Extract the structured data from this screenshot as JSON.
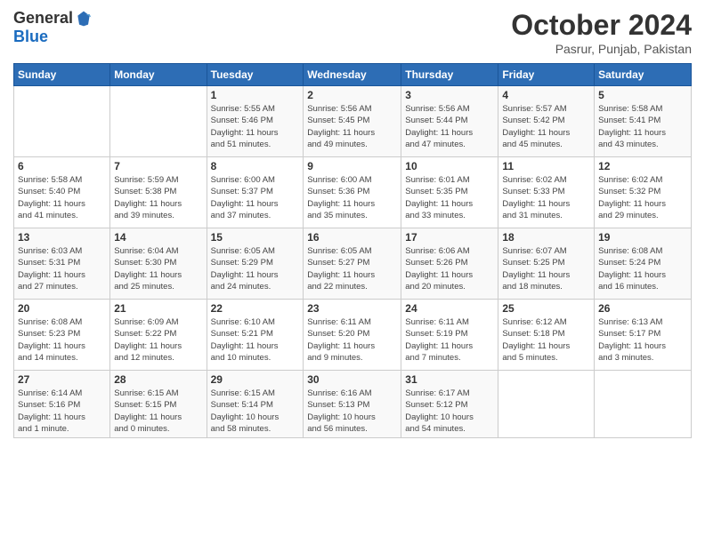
{
  "header": {
    "logo": {
      "general": "General",
      "blue": "Blue"
    },
    "title": "October 2024",
    "location": "Pasrur, Punjab, Pakistan"
  },
  "columns": [
    "Sunday",
    "Monday",
    "Tuesday",
    "Wednesday",
    "Thursday",
    "Friday",
    "Saturday"
  ],
  "weeks": [
    [
      {
        "day": "",
        "info": ""
      },
      {
        "day": "",
        "info": ""
      },
      {
        "day": "1",
        "info": "Sunrise: 5:55 AM\nSunset: 5:46 PM\nDaylight: 11 hours\nand 51 minutes."
      },
      {
        "day": "2",
        "info": "Sunrise: 5:56 AM\nSunset: 5:45 PM\nDaylight: 11 hours\nand 49 minutes."
      },
      {
        "day": "3",
        "info": "Sunrise: 5:56 AM\nSunset: 5:44 PM\nDaylight: 11 hours\nand 47 minutes."
      },
      {
        "day": "4",
        "info": "Sunrise: 5:57 AM\nSunset: 5:42 PM\nDaylight: 11 hours\nand 45 minutes."
      },
      {
        "day": "5",
        "info": "Sunrise: 5:58 AM\nSunset: 5:41 PM\nDaylight: 11 hours\nand 43 minutes."
      }
    ],
    [
      {
        "day": "6",
        "info": "Sunrise: 5:58 AM\nSunset: 5:40 PM\nDaylight: 11 hours\nand 41 minutes."
      },
      {
        "day": "7",
        "info": "Sunrise: 5:59 AM\nSunset: 5:38 PM\nDaylight: 11 hours\nand 39 minutes."
      },
      {
        "day": "8",
        "info": "Sunrise: 6:00 AM\nSunset: 5:37 PM\nDaylight: 11 hours\nand 37 minutes."
      },
      {
        "day": "9",
        "info": "Sunrise: 6:00 AM\nSunset: 5:36 PM\nDaylight: 11 hours\nand 35 minutes."
      },
      {
        "day": "10",
        "info": "Sunrise: 6:01 AM\nSunset: 5:35 PM\nDaylight: 11 hours\nand 33 minutes."
      },
      {
        "day": "11",
        "info": "Sunrise: 6:02 AM\nSunset: 5:33 PM\nDaylight: 11 hours\nand 31 minutes."
      },
      {
        "day": "12",
        "info": "Sunrise: 6:02 AM\nSunset: 5:32 PM\nDaylight: 11 hours\nand 29 minutes."
      }
    ],
    [
      {
        "day": "13",
        "info": "Sunrise: 6:03 AM\nSunset: 5:31 PM\nDaylight: 11 hours\nand 27 minutes."
      },
      {
        "day": "14",
        "info": "Sunrise: 6:04 AM\nSunset: 5:30 PM\nDaylight: 11 hours\nand 25 minutes."
      },
      {
        "day": "15",
        "info": "Sunrise: 6:05 AM\nSunset: 5:29 PM\nDaylight: 11 hours\nand 24 minutes."
      },
      {
        "day": "16",
        "info": "Sunrise: 6:05 AM\nSunset: 5:27 PM\nDaylight: 11 hours\nand 22 minutes."
      },
      {
        "day": "17",
        "info": "Sunrise: 6:06 AM\nSunset: 5:26 PM\nDaylight: 11 hours\nand 20 minutes."
      },
      {
        "day": "18",
        "info": "Sunrise: 6:07 AM\nSunset: 5:25 PM\nDaylight: 11 hours\nand 18 minutes."
      },
      {
        "day": "19",
        "info": "Sunrise: 6:08 AM\nSunset: 5:24 PM\nDaylight: 11 hours\nand 16 minutes."
      }
    ],
    [
      {
        "day": "20",
        "info": "Sunrise: 6:08 AM\nSunset: 5:23 PM\nDaylight: 11 hours\nand 14 minutes."
      },
      {
        "day": "21",
        "info": "Sunrise: 6:09 AM\nSunset: 5:22 PM\nDaylight: 11 hours\nand 12 minutes."
      },
      {
        "day": "22",
        "info": "Sunrise: 6:10 AM\nSunset: 5:21 PM\nDaylight: 11 hours\nand 10 minutes."
      },
      {
        "day": "23",
        "info": "Sunrise: 6:11 AM\nSunset: 5:20 PM\nDaylight: 11 hours\nand 9 minutes."
      },
      {
        "day": "24",
        "info": "Sunrise: 6:11 AM\nSunset: 5:19 PM\nDaylight: 11 hours\nand 7 minutes."
      },
      {
        "day": "25",
        "info": "Sunrise: 6:12 AM\nSunset: 5:18 PM\nDaylight: 11 hours\nand 5 minutes."
      },
      {
        "day": "26",
        "info": "Sunrise: 6:13 AM\nSunset: 5:17 PM\nDaylight: 11 hours\nand 3 minutes."
      }
    ],
    [
      {
        "day": "27",
        "info": "Sunrise: 6:14 AM\nSunset: 5:16 PM\nDaylight: 11 hours\nand 1 minute."
      },
      {
        "day": "28",
        "info": "Sunrise: 6:15 AM\nSunset: 5:15 PM\nDaylight: 11 hours\nand 0 minutes."
      },
      {
        "day": "29",
        "info": "Sunrise: 6:15 AM\nSunset: 5:14 PM\nDaylight: 10 hours\nand 58 minutes."
      },
      {
        "day": "30",
        "info": "Sunrise: 6:16 AM\nSunset: 5:13 PM\nDaylight: 10 hours\nand 56 minutes."
      },
      {
        "day": "31",
        "info": "Sunrise: 6:17 AM\nSunset: 5:12 PM\nDaylight: 10 hours\nand 54 minutes."
      },
      {
        "day": "",
        "info": ""
      },
      {
        "day": "",
        "info": ""
      }
    ]
  ]
}
